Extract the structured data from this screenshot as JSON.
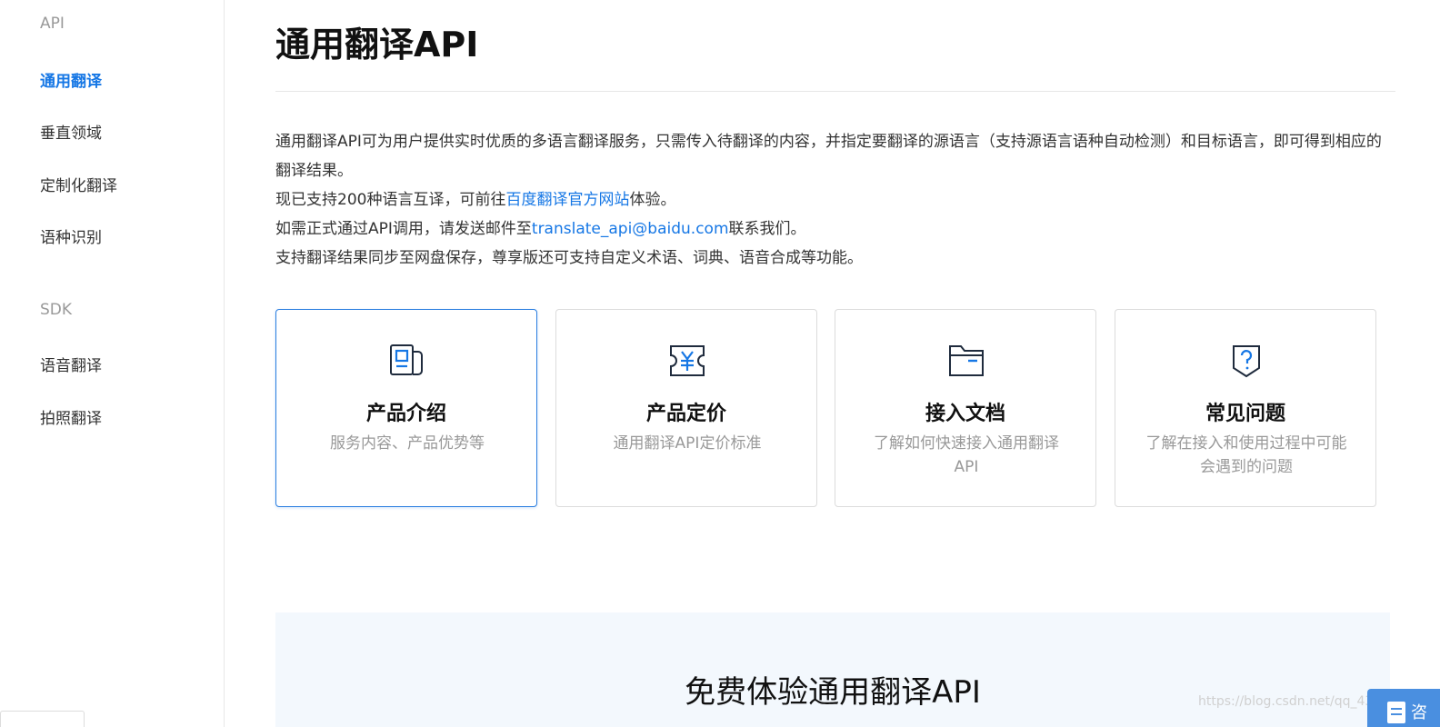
{
  "sidebar": {
    "api_group_title": "API",
    "api_items": [
      {
        "label": "通用翻译",
        "active": true
      },
      {
        "label": "垂直领域",
        "active": false
      },
      {
        "label": "定制化翻译",
        "active": false
      },
      {
        "label": "语种识别",
        "active": false
      }
    ],
    "sdk_group_title": "SDK",
    "sdk_items": [
      {
        "label": "语音翻译"
      },
      {
        "label": "拍照翻译"
      }
    ]
  },
  "main": {
    "title": "通用翻译API",
    "intro": {
      "p1": "通用翻译API可为用户提供实时优质的多语言翻译服务，只需传入待翻译的内容，并指定要翻译的源语言（支持源语言语种自动检测）和目标语言，即可得到相应的翻译结果。",
      "p2_prefix": "现已支持200种语言互译，可前往",
      "p2_link": "百度翻译官方网站",
      "p2_suffix": "体验。",
      "p3_prefix": "如需正式通过API调用，请发送邮件至",
      "p3_link": "translate_api@baidu.com",
      "p3_suffix": "联系我们。",
      "p4": "支持翻译结果同步至网盘保存，尊享版还可支持自定义术语、词典、语音合成等功能。"
    },
    "cards": [
      {
        "icon": "product-intro-icon",
        "title": "产品介绍",
        "desc": "服务内容、产品优势等",
        "selected": true
      },
      {
        "icon": "pricing-icon",
        "title": "产品定价",
        "desc": "通用翻译API定价标准",
        "selected": false
      },
      {
        "icon": "folder-doc-icon",
        "title": "接入文档",
        "desc": "了解如何快速接入通用翻译API",
        "selected": false
      },
      {
        "icon": "question-shield-icon",
        "title": "常见问题",
        "desc": "了解在接入和使用过程中可能会遇到的问题",
        "selected": false
      }
    ],
    "banner_title": "免费体验通用翻译API"
  },
  "watermark": "https://blog.csdn.net/qq_43474959",
  "float_button_label": "咨",
  "colors": {
    "accent": "#1677e5",
    "banner_bg": "#f3f8fd",
    "muted_text": "#999999"
  }
}
